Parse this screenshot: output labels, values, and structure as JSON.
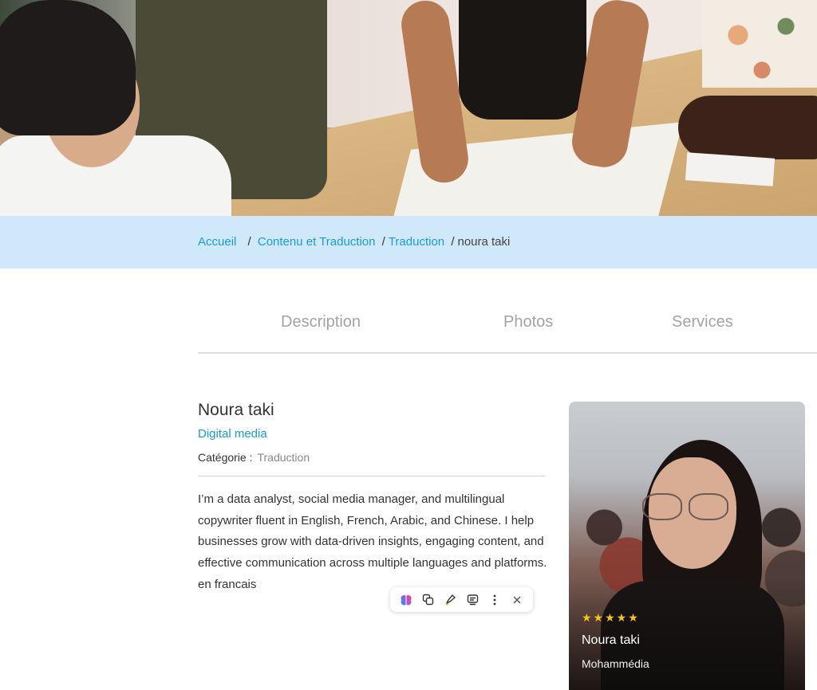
{
  "breadcrumb": {
    "home": "Accueil",
    "category": "Contenu et Traduction",
    "subcategory": "Traduction",
    "current": "noura taki",
    "separator": "/"
  },
  "tabs": [
    "Description",
    "Photos",
    "Services"
  ],
  "profile": {
    "name": "Noura taki",
    "specialty": "Digital media",
    "category_label": "Catégorie :",
    "category_value": "Traduction",
    "bio": "I’m a data analyst, social media manager, and multilingual copywriter fluent in English, French, Arabic, and Chinese. I help businesses grow with data-driven insights, engaging content, and effective communication across multiple languages and platforms. en francais"
  },
  "card": {
    "stars": "★★★★★",
    "rating": 5,
    "name": "Noura taki",
    "city": "Mohammédia"
  },
  "toolbar": {
    "icons": [
      "brain-icon",
      "copy-icon",
      "highlight-icon",
      "note-icon",
      "more-icon",
      "close-icon"
    ]
  },
  "colors": {
    "accent": "#1a9ad6",
    "breadcrumb_bg": "#cfe9fa",
    "star": "#f5c518"
  }
}
